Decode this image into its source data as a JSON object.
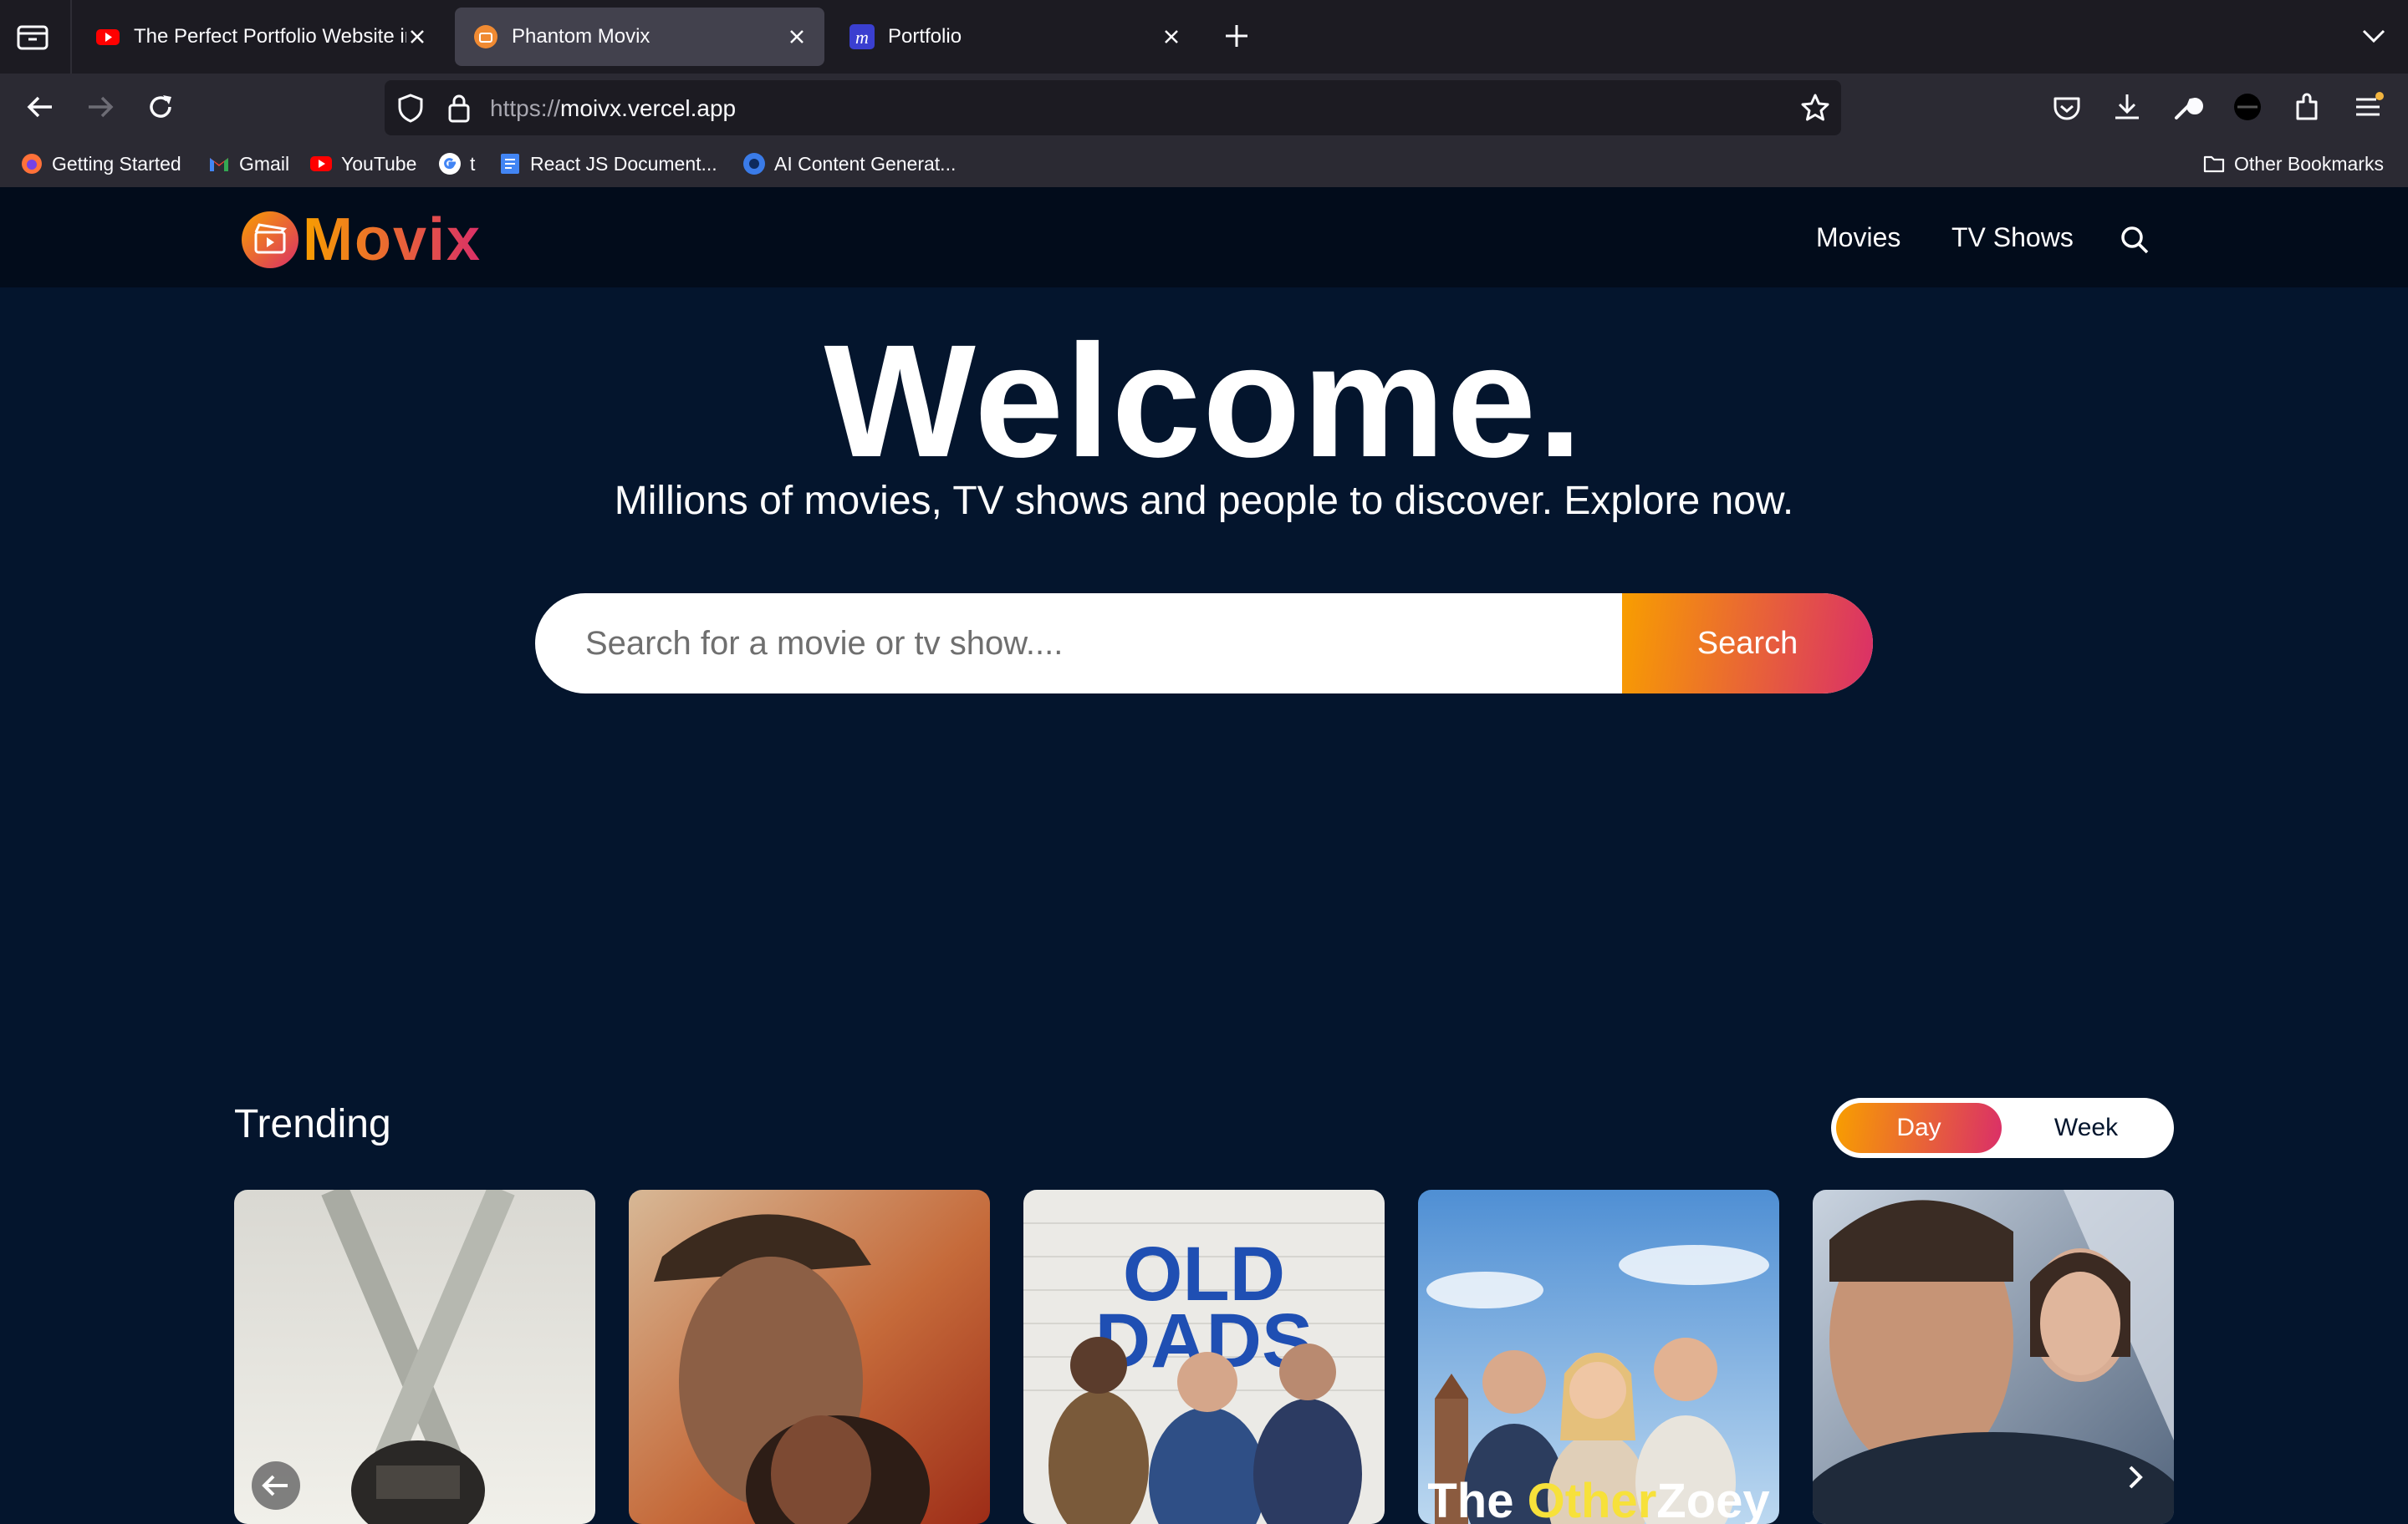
{
  "browser": {
    "tabs": [
      {
        "label": "The Perfect Portfolio Website in",
        "favicon": "youtube-icon",
        "active": false
      },
      {
        "label": "Phantom Movix",
        "favicon": "movix-icon",
        "active": true
      },
      {
        "label": "Portfolio",
        "favicon": "portfolio-m-icon",
        "active": false
      }
    ],
    "url_protocol": "https://",
    "url_host": "moivx.vercel.app",
    "bookmarks": [
      {
        "label": "Getting Started",
        "icon": "firefox-icon"
      },
      {
        "label": "Gmail",
        "icon": "gmail-icon"
      },
      {
        "label": "YouTube",
        "icon": "youtube-icon"
      },
      {
        "label": "t",
        "icon": "google-icon"
      },
      {
        "label": "React JS Document...",
        "icon": "docs-icon"
      },
      {
        "label": "AI Content Generat...",
        "icon": "ai-icon"
      },
      {
        "label": "Other Bookmarks",
        "icon": "folder-icon"
      }
    ]
  },
  "site": {
    "logo_text": "Movix",
    "menu": {
      "movies": "Movies",
      "tv_shows": "TV Shows"
    },
    "hero": {
      "title": "Welcome.",
      "subtitle": "Millions of movies, TV shows and people to discover. Explore now.",
      "search_placeholder": "Search for a movie or tv show....",
      "search_button": "Search"
    },
    "trending": {
      "title": "Trending",
      "switch": {
        "day": "Day",
        "week": "Week",
        "selected": "Day"
      },
      "posters": [
        {
          "title_text": ""
        },
        {
          "title_text": ""
        },
        {
          "title_text": "OLD DADS"
        },
        {
          "title_text": "The Other Zoey"
        },
        {
          "title_text": ""
        }
      ]
    }
  },
  "colors": {
    "page_bg": "#04152d",
    "header_bg": "#020c1b",
    "gradient_start": "#f89e00",
    "gradient_end": "#da2f68"
  }
}
